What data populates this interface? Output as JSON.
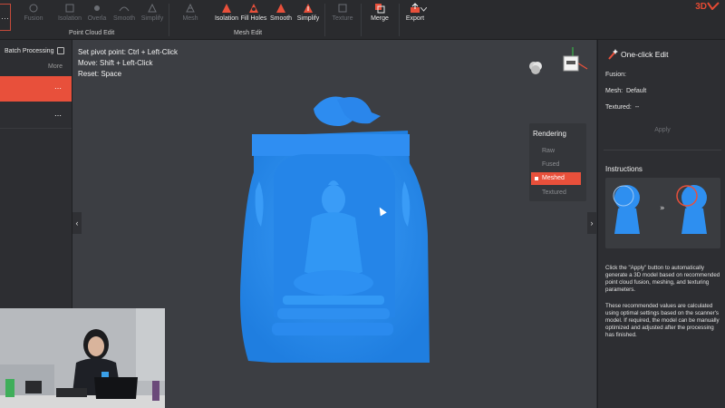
{
  "toolbar": {
    "brand": "3D",
    "menu_glyph": "⋯",
    "buttons": [
      {
        "label": "Fusion",
        "icon": "fusion-icon",
        "active": false
      },
      {
        "label": "Isolation",
        "icon": "isolation-icon",
        "active": false
      },
      {
        "label": "Overla",
        "icon": "overlap-icon",
        "active": false
      },
      {
        "label": "Smooth",
        "icon": "smooth-icon",
        "active": false
      },
      {
        "label": "Simplify",
        "icon": "simplify-icon",
        "active": false
      },
      {
        "label": "Mesh",
        "icon": "mesh-icon",
        "active": false
      },
      {
        "label": "Isolation",
        "icon": "isolation-icon",
        "active": true
      },
      {
        "label": "Fill Holes",
        "icon": "fill-holes-icon",
        "active": true
      },
      {
        "label": "Smooth",
        "icon": "smooth-icon",
        "active": true
      },
      {
        "label": "Simplify",
        "icon": "simplify-icon",
        "active": true
      },
      {
        "label": "Texture",
        "icon": "texture-icon",
        "active": false
      },
      {
        "label": "Merge",
        "icon": "merge-icon",
        "active": true
      },
      {
        "label": "Export",
        "icon": "export-icon",
        "active": true
      }
    ],
    "groups": {
      "point_cloud_edit": "Point Cloud Edit",
      "mesh_edit": "Mesh Edit"
    },
    "accent": "#e8503b"
  },
  "left_panel": {
    "title": "Batch Processing",
    "more": "More",
    "item_menu": "⋯"
  },
  "viewport": {
    "hints": [
      "Set pivot point: Ctrl + Left-Click",
      "Move: Shift + Left-Click",
      "Reset: Space"
    ],
    "model_color": "#2e8ff0",
    "rendering": {
      "title": "Rendering",
      "options": [
        {
          "label": "Raw",
          "active": false
        },
        {
          "label": "Fused",
          "active": false
        },
        {
          "label": "Meshed",
          "active": true
        },
        {
          "label": "Textured",
          "active": false
        }
      ]
    },
    "collapse_left": "‹",
    "collapse_right": "›"
  },
  "right_panel": {
    "title": "One-click Edit",
    "fusion_label": "Fusion:",
    "mesh_label": "Mesh:",
    "mesh_value": "Default",
    "textured_label": "Textured:",
    "textured_value": "--",
    "apply": "Apply",
    "instructions_title": "Instructions",
    "arrows": "»",
    "instruction_p1": "Click the \"Apply\" button to automatically generate a 3D model based on recommended point cloud fusion, meshing, and texturing parameters.",
    "instruction_p2": "These recommended values are calculated using optimal settings based on the scanner's model. If required, the model can be manually optimized and adjusted after the processing has finished."
  }
}
